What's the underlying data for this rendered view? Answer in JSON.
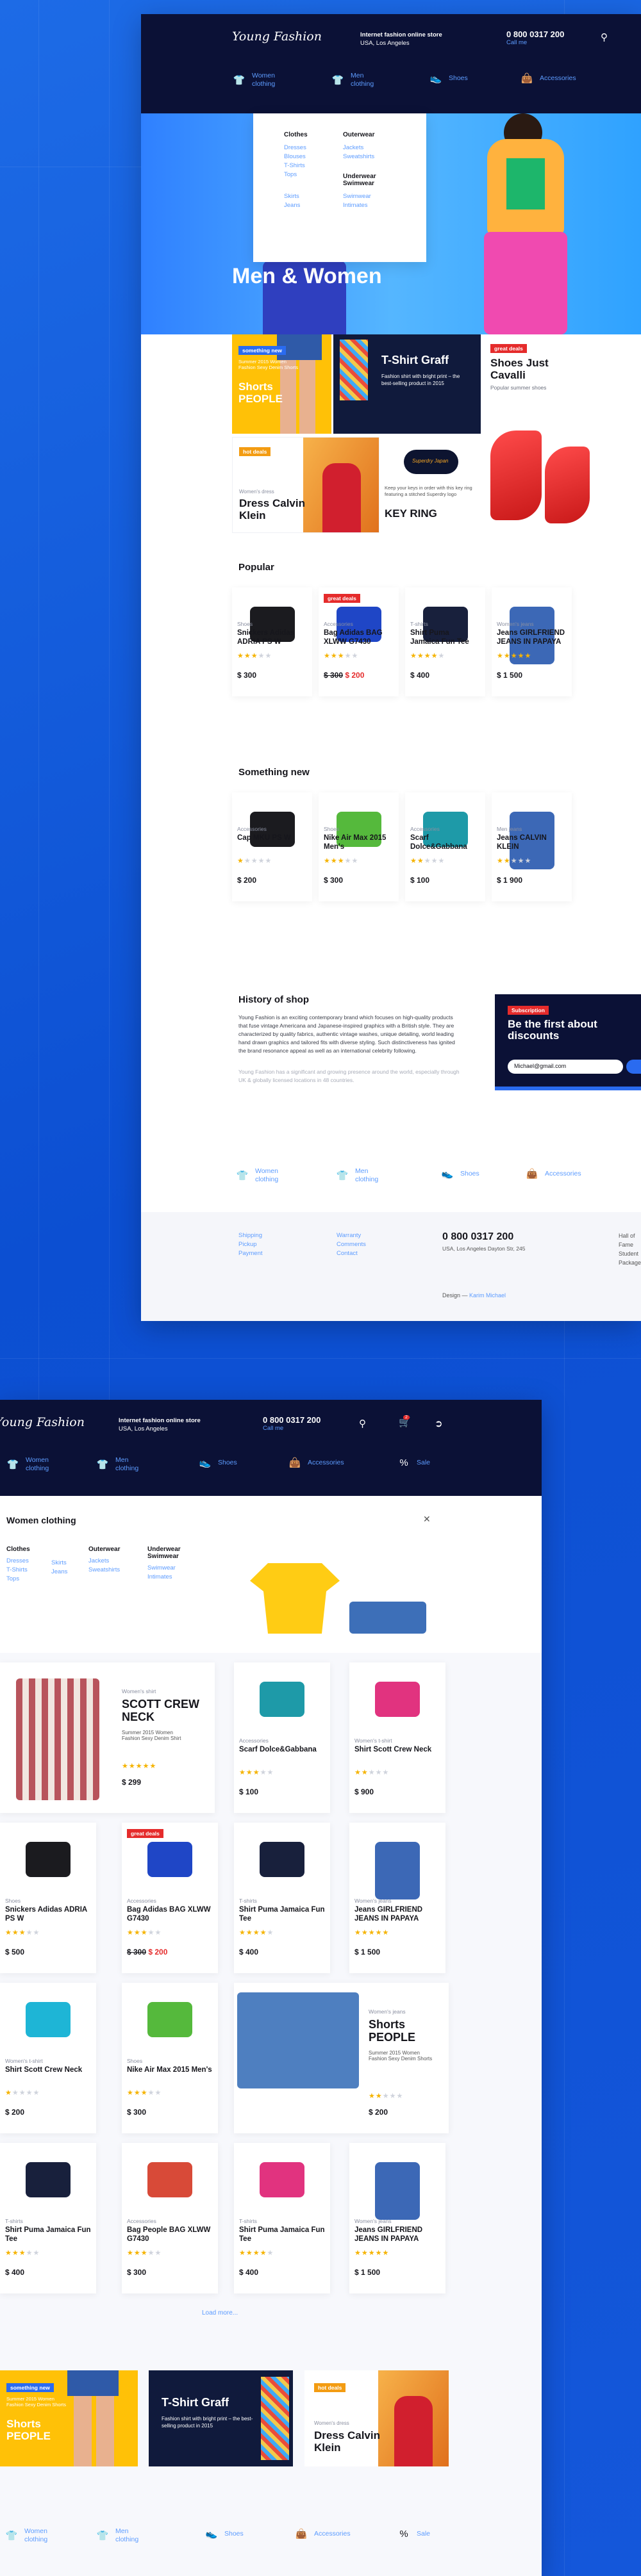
{
  "top": {
    "logo": "Young Fashion",
    "store_line1": "Internet fashion online store",
    "store_line2": "USA, Los Angeles",
    "phone": "0 800 0317 200",
    "call": "Call me",
    "nav": [
      {
        "l1": "Women",
        "l2": "clothing"
      },
      {
        "l1": "Men",
        "l2": "clothing"
      },
      {
        "l1": "Shoes",
        "l2": ""
      },
      {
        "l1": "Accessories",
        "l2": ""
      }
    ],
    "mega": {
      "col1_title": "Clothes",
      "col1": [
        "Dresses",
        "Blouses",
        "T-Shirts",
        "Tops",
        "",
        "Skirts",
        "Jeans"
      ],
      "col2_title": "Outerwear",
      "col2": [
        "Jackets",
        "Sweatshirts"
      ],
      "col3_title": "Underwear Swimwear",
      "col3": [
        "Swimwear",
        "Intimates"
      ]
    },
    "hero_title": "Men & Women",
    "promo": {
      "p1_badge": "something new",
      "p1_sub": "Summer 2015 Women Fashion Sexy Denim Shorts",
      "p1_title": "Shorts PEOPLE",
      "p2_title": "T-Shirt Graff",
      "p2_sub": "Fashion shirt with bright print – the best-selling product in 2015",
      "p3_badge": "great deals",
      "p3_title": "Shoes Just Cavalli",
      "p3_sub": "Popular summer shoes",
      "p4_badge": "hot deals",
      "p4_cat": "Women's dress",
      "p4_title": "Dress Calvin Klein",
      "p5_sub": "Keep your keys in order with this key ring featuring a stitched Superdry logo",
      "p5_title": "KEY RING",
      "p5_tag": "Superdry Japan"
    },
    "popular_title": "Popular",
    "popular": [
      {
        "cat": "Shoes",
        "name": "Snickers Adidas ADRIA PS W",
        "price": "$ 300",
        "stars": 3,
        "badge": ""
      },
      {
        "cat": "Accessories",
        "name": "Bag Adidas BAG XLWW G7430",
        "price_old": "$ 300",
        "price": "$ 200",
        "stars": 3,
        "badge": "great deals"
      },
      {
        "cat": "T-shirts",
        "name": "Shirt Puma Jamaica Fun Tee",
        "price": "$ 400",
        "stars": 4,
        "badge": ""
      },
      {
        "cat": "Women's jeans",
        "name": "Jeans GIRLFRIEND JEANS IN PAPAYA",
        "price": "$ 1 500",
        "stars": 5,
        "badge": ""
      }
    ],
    "new_title": "Something new",
    "newitems": [
      {
        "cat": "Accessories",
        "name": "Cap MKU PS W",
        "price": "$ 200",
        "stars": 1
      },
      {
        "cat": "Shoes",
        "name": "Nike Air Max 2015 Men's",
        "price": "$ 300",
        "stars": 3
      },
      {
        "cat": "Accessories",
        "name": "Scarf Dolce&Gabbana",
        "price": "$ 100",
        "stars": 2
      },
      {
        "cat": "Men jeans",
        "name": "Jeans CALVIN KLEIN",
        "price": "$ 1 900",
        "stars": 2
      }
    ],
    "history_title": "History of shop",
    "history_p1": "Young Fashion is an exciting contemporary brand which focuses on high-quality products that fuse vintage Americana and Japanese-inspired graphics with a British style. They are characterized by quality fabrics, authentic vintage washes, unique detailing, world leading hand drawn graphics and tailored fits with diverse styling. Such distinctiveness has ignited the brand resonance appeal as well as an international celebrity following.",
    "history_p2": "Young Fashion has a significant and growing presence around the world, especially through UK & globally licensed locations in 48 countries.",
    "subs_badge": "Subscription",
    "subs_title": "Be the first about discounts",
    "subs_email": "Michael@gmail.com",
    "footer_nav": [
      {
        "l1": "Women",
        "l2": "clothing"
      },
      {
        "l1": "Men",
        "l2": "clothing"
      },
      {
        "l1": "Shoes",
        "l2": ""
      },
      {
        "l1": "Accessories",
        "l2": ""
      }
    ],
    "footer_links1": [
      "Shipping",
      "Pickup",
      "Payment"
    ],
    "footer_links2": [
      "Warranty",
      "Comments",
      "Contact"
    ],
    "footer_phone": "0 800 0317 200",
    "footer_addr": "USA, Los Angeles Dayton Str, 245",
    "footer_links3": [
      "Hall of Fame",
      "Student",
      "Package"
    ],
    "design_by": "Design —",
    "designer": "Karim Michael"
  },
  "bottom": {
    "logo": "Young Fashion",
    "store_line1": "Internet fashion online store",
    "store_line2": "USA, Los Angeles",
    "phone": "0 800 0317 200",
    "call": "Call me",
    "cart_count": "2",
    "nav": [
      {
        "l1": "Women",
        "l2": "clothing"
      },
      {
        "l1": "Men",
        "l2": "clothing"
      },
      {
        "l1": "Shoes",
        "l2": ""
      },
      {
        "l1": "Accessories",
        "l2": ""
      },
      {
        "l1": "Sale",
        "l2": ""
      }
    ],
    "panel_title": "Women clothing",
    "mega": {
      "col1_title": "Clothes",
      "col1": [
        "Dresses",
        "T-Shirts",
        "Tops"
      ],
      "col1b": [
        "Skirts",
        "Jeans"
      ],
      "col2_title": "Outerwear",
      "col2": [
        "Jackets",
        "Sweatshirts"
      ],
      "col3_title": "Underwear Swimwear",
      "col3": [
        "Swimwear",
        "Intimates"
      ]
    },
    "feature": {
      "cat": "Women's shirt",
      "name": "SCOTT CREW NECK",
      "sub": "Summer 2015 Women Fashion Sexy Denim Shirt",
      "price": "$ 299",
      "stars": 5
    },
    "row1": [
      {
        "cat": "Accessories",
        "name": "Scarf Dolce&Gabbana",
        "price": "$ 100",
        "stars": 3
      },
      {
        "cat": "Women's t-shirt",
        "name": "Shirt Scott Crew Neck",
        "price": "$ 900",
        "stars": 2
      }
    ],
    "row2": [
      {
        "cat": "Shoes",
        "name": "Snickers Adidas ADRIA PS W",
        "price": "$ 500",
        "stars": 3,
        "badge": ""
      },
      {
        "cat": "Accessories",
        "name": "Bag Adidas BAG XLWW G7430",
        "price_old": "$ 300",
        "price": "$ 200",
        "stars": 3,
        "badge": "great deals"
      },
      {
        "cat": "T-shirts",
        "name": "Shirt Puma Jamaica Fun Tee",
        "price": "$ 400",
        "stars": 4,
        "badge": ""
      },
      {
        "cat": "Women's jeans",
        "name": "Jeans GIRLFRIEND JEANS IN PAPAYA",
        "price": "$ 1 500",
        "stars": 5,
        "badge": ""
      }
    ],
    "row3": [
      {
        "cat": "Women's t-shirt",
        "name": "Shirt Scott Crew Neck",
        "price": "$ 200",
        "stars": 1
      },
      {
        "cat": "Shoes",
        "name": "Nike Air Max 2015 Men's",
        "price": "$ 300",
        "stars": 3
      }
    ],
    "feature2": {
      "cat": "Women's jeans",
      "name": "Shorts PEOPLE",
      "sub": "Summer 2015 Women Fashion Sexy Denim Shorts",
      "price": "$ 200",
      "stars": 2
    },
    "row4": [
      {
        "cat": "T-shirts",
        "name": "Shirt Puma Jamaica Fun Tee",
        "price": "$ 400",
        "stars": 3
      },
      {
        "cat": "Accessories",
        "name": "Bag People BAG XLWW G7430",
        "price": "$ 300",
        "stars": 3
      },
      {
        "cat": "T-shirts",
        "name": "Shirt Puma Jamaica Fun Tee",
        "price": "$ 400",
        "stars": 4
      },
      {
        "cat": "Women's jeans",
        "name": "Jeans GIRLFRIEND JEANS IN PAPAYA",
        "price": "$ 1 500",
        "stars": 5
      }
    ],
    "load_more": "Load more...",
    "promo": {
      "p1_badge": "something new",
      "p1_sub": "Summer 2015 Women Fashion Sexy Denim Shorts",
      "p1_title": "Shorts PEOPLE",
      "p2_title": "T-Shirt Graff",
      "p2_sub": "Fashion shirt with bright print – the best-selling product in 2015",
      "p3_badge": "hot deals",
      "p3_cat": "Women's dress",
      "p3_title": "Dress Calvin Klein"
    },
    "footer_nav": [
      {
        "l1": "Women",
        "l2": "clothing"
      },
      {
        "l1": "Men",
        "l2": "clothing"
      },
      {
        "l1": "Shoes",
        "l2": ""
      },
      {
        "l1": "Accessories",
        "l2": ""
      },
      {
        "l1": "Sale",
        "l2": ""
      }
    ]
  },
  "colors": {
    "navy": "#0b1136",
    "blue_bg": "#0f4dcc",
    "link": "#5d9cff",
    "yellow": "#ffc107",
    "red": "#e52b2b",
    "orange": "#f39c12",
    "star": "#f5b301"
  }
}
